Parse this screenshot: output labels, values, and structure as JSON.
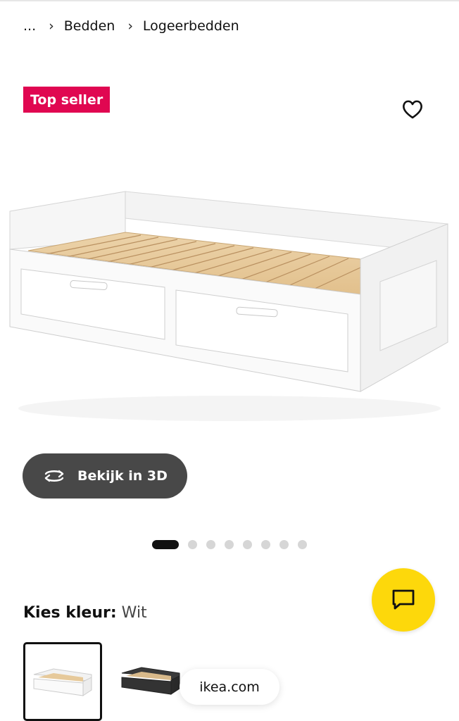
{
  "breadcrumb": {
    "items": [
      "...",
      "Bedden",
      "Logeerbedden"
    ],
    "separator": "›"
  },
  "badge": {
    "label": "Top seller",
    "color": "#e00751"
  },
  "favorite": {
    "icon": "heart-outline-icon"
  },
  "gallery": {
    "view3d_label": "Bekijk in 3D",
    "view3d_icon": "rotate-3d-icon",
    "total_images": 8,
    "active_index": 0
  },
  "chat": {
    "icon": "chat-bubble-icon",
    "color": "#fdd80b"
  },
  "color_picker": {
    "label": "Kies kleur:",
    "selected": "Wit",
    "options": [
      "Wit",
      "Zwart"
    ]
  },
  "footer_pill": {
    "label": "ikea.com"
  }
}
